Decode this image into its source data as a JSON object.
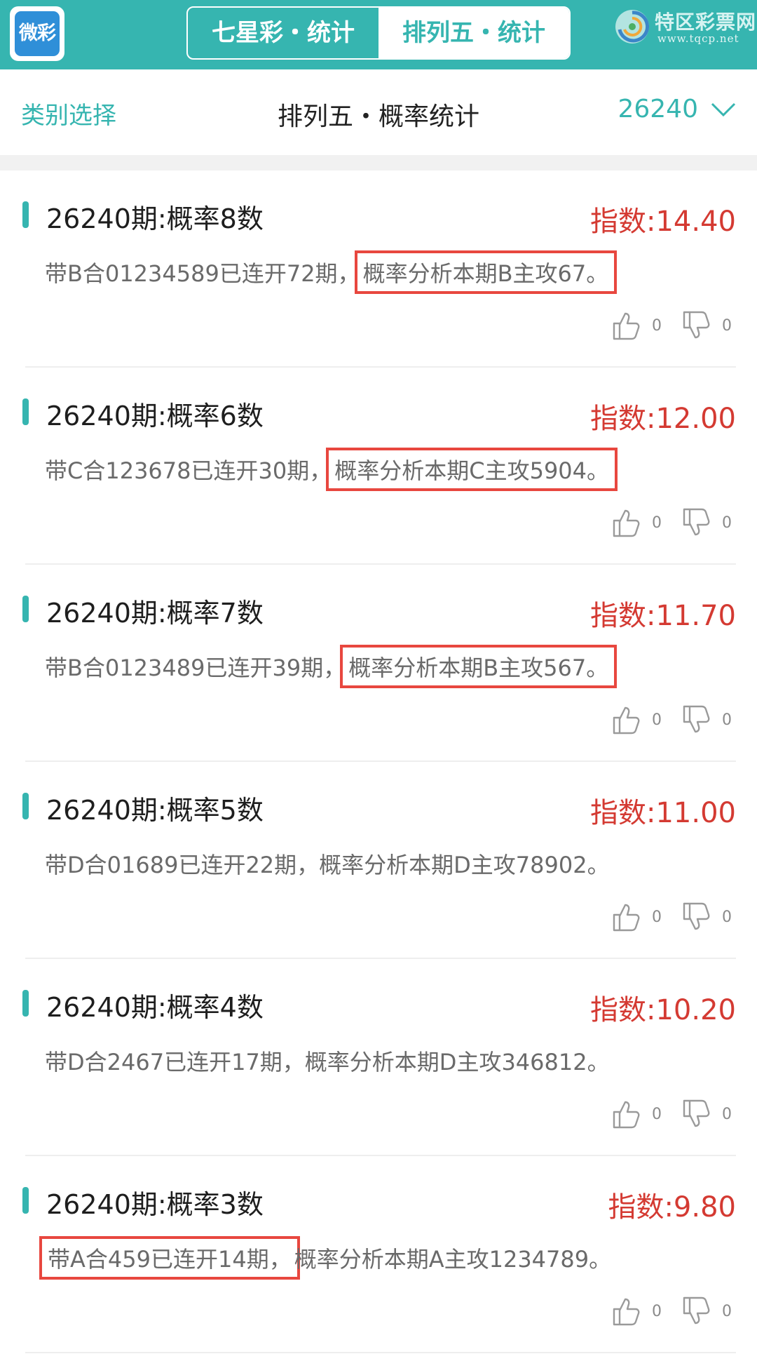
{
  "app": {
    "logo_text": "微彩"
  },
  "header": {
    "tabs": [
      {
        "label": "七星彩・统计",
        "active": false
      },
      {
        "label": "排列五・统计",
        "active": true
      }
    ],
    "site_name": "特区彩票网",
    "site_url": "www.tqcp.net"
  },
  "subheader": {
    "category_label": "类别选择",
    "title": "排列五・概率统计",
    "period": "26240"
  },
  "colors": {
    "accent": "#36b5b0",
    "index_red": "#d43a32",
    "highlight_border": "#e8473f"
  },
  "items": [
    {
      "title": "26240期:概率8数",
      "index": "指数:14.40",
      "text_pre": "带B合01234589已连开72期，",
      "text_hl": "概率分析本期B主攻67。",
      "text_post": "",
      "highlight": "second",
      "likes": "0",
      "dislikes": "0"
    },
    {
      "title": "26240期:概率6数",
      "index": "指数:12.00",
      "text_pre": "带C合123678已连开30期，",
      "text_hl": "概率分析本期C主攻5904。",
      "text_post": "",
      "highlight": "second",
      "likes": "0",
      "dislikes": "0"
    },
    {
      "title": "26240期:概率7数",
      "index": "指数:11.70",
      "text_pre": "带B合0123489已连开39期，",
      "text_hl": "概率分析本期B主攻567。",
      "text_post": "",
      "highlight": "second",
      "likes": "0",
      "dislikes": "0"
    },
    {
      "title": "26240期:概率5数",
      "index": "指数:11.00",
      "text_pre": "带D合01689已连开22期，概率分析本期D主攻78902。",
      "text_hl": "",
      "text_post": "",
      "highlight": "none",
      "likes": "0",
      "dislikes": "0"
    },
    {
      "title": "26240期:概率4数",
      "index": "指数:10.20",
      "text_pre": "带D合2467已连开17期，概率分析本期D主攻346812。",
      "text_hl": "",
      "text_post": "",
      "highlight": "none",
      "likes": "0",
      "dislikes": "0"
    },
    {
      "title": "26240期:概率3数",
      "index": "指数:9.80",
      "text_pre": "",
      "text_hl": "带A合459已连开14期，",
      "text_post": "概率分析本期A主攻1234789。",
      "highlight": "first",
      "likes": "0",
      "dislikes": "0"
    }
  ]
}
